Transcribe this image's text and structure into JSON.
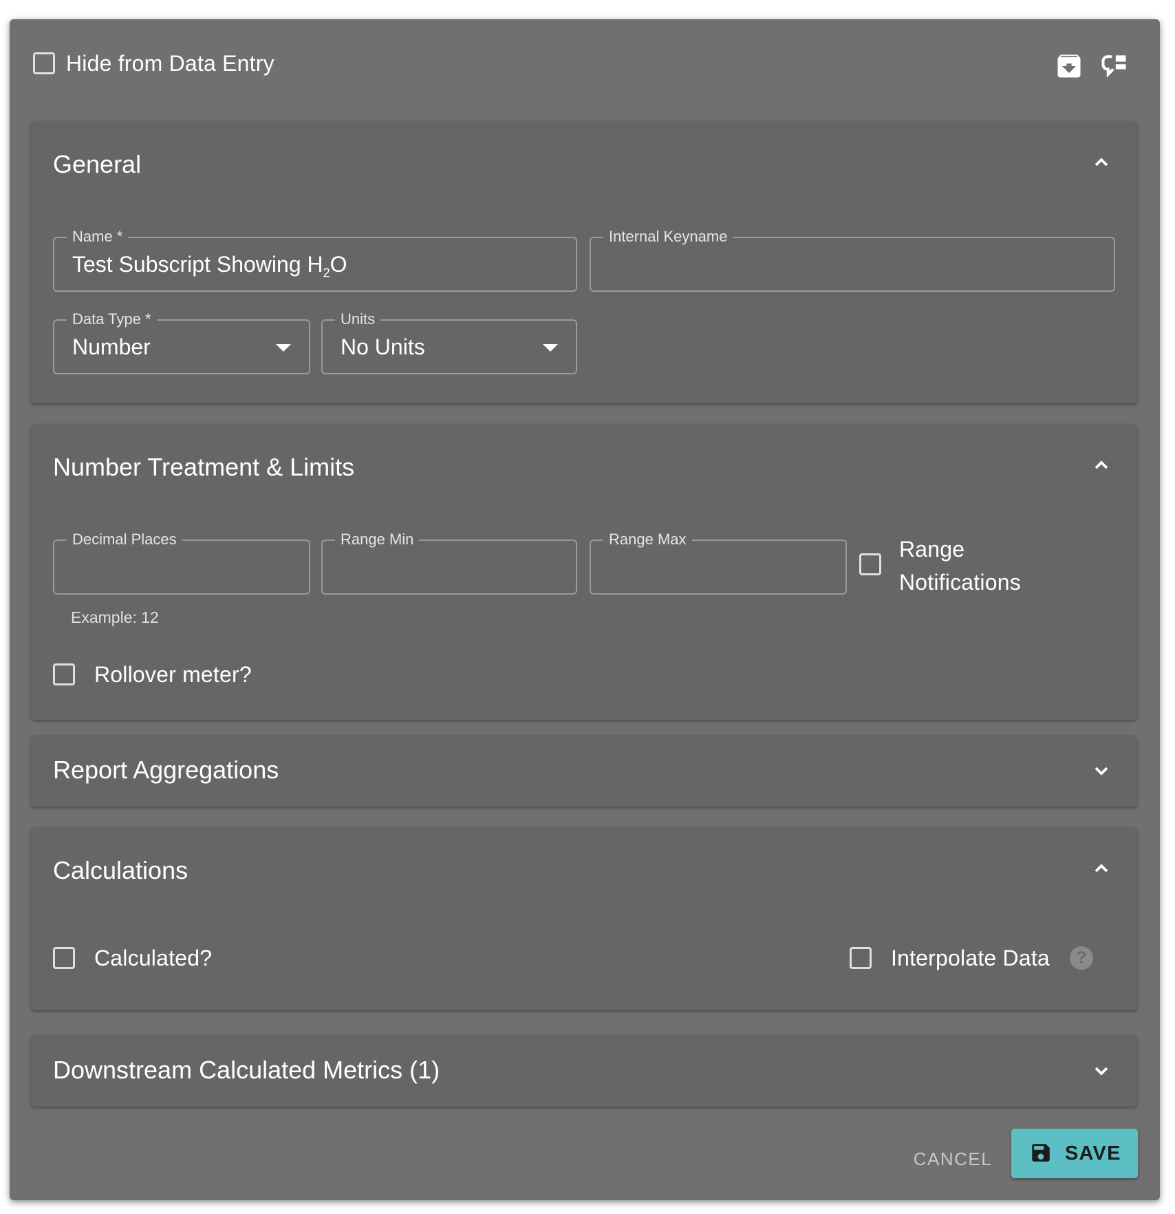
{
  "top": {
    "hide_label": "Hide from Data Entry",
    "icons": [
      "archive-icon",
      "comment-list-icon"
    ]
  },
  "general": {
    "title": "General",
    "name_label": "Name *",
    "name_value_prefix": "Test Subscript Showing H",
    "name_value_sub": "2",
    "name_value_suffix": "O",
    "keyname_label": "Internal Keyname",
    "keyname_value": "",
    "datatype_label": "Data Type *",
    "datatype_value": "Number",
    "units_label": "Units",
    "units_value": "No Units"
  },
  "number_treatment": {
    "title": "Number Treatment & Limits",
    "decimal_label": "Decimal Places",
    "decimal_helper": "Example: 12",
    "range_min_label": "Range Min",
    "range_max_label": "Range Max",
    "range_notifications_line1": "Range",
    "range_notifications_line2": "Notifications",
    "rollover_label": "Rollover meter?"
  },
  "report_aggregations": {
    "title": "Report Aggregations"
  },
  "calculations": {
    "title": "Calculations",
    "calculated_label": "Calculated?",
    "interpolate_label": "Interpolate Data",
    "help_glyph": "?"
  },
  "downstream": {
    "title": "Downstream Calculated Metrics (1)"
  },
  "actions": {
    "cancel_label": "CANCEL",
    "save_label": "SAVE"
  },
  "colors": {
    "dialog_bg": "#707070",
    "panel_bg": "#666666",
    "save_button": "#5bbfc4"
  }
}
